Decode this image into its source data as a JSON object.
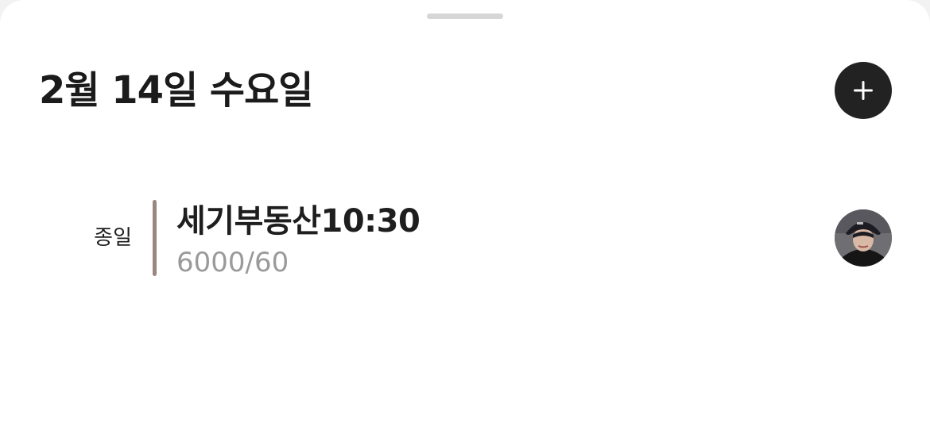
{
  "header": {
    "date_title": "2월 14일 수요일",
    "add_icon": "plus-icon"
  },
  "events": [
    {
      "time_label": "종일",
      "title": "세기부동산10:30",
      "subtitle": "6000/60",
      "bar_color": "#9b8680",
      "avatar_icon": "user-avatar"
    }
  ],
  "colors": {
    "background": "#ffffff",
    "add_button": "#222222",
    "subtitle_text": "#9a9a9a"
  }
}
